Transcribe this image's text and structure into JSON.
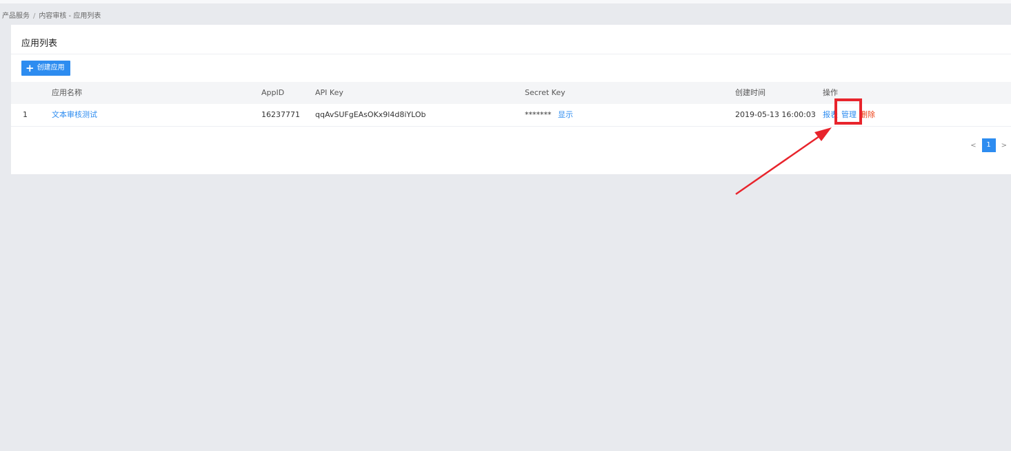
{
  "breadcrumb": {
    "root": "产品服务",
    "separator": "/",
    "current": "内容审核 - 应用列表"
  },
  "card": {
    "title": "应用列表",
    "create_button_label": "创建应用"
  },
  "table": {
    "headers": {
      "index": "",
      "name": "应用名称",
      "appid": "AppID",
      "api_key": "API Key",
      "secret_key": "Secret Key",
      "created": "创建时间",
      "actions": "操作"
    },
    "rows": [
      {
        "index": "1",
        "name": "文本审核测试",
        "appid": "16237771",
        "api_key": "qqAvSUFgEAsOKx9l4d8iYLOb",
        "secret_key_masked": "*******",
        "show_label": "显示",
        "created": "2019-05-13 16:00:03",
        "actions": {
          "report": "报表",
          "manage": "管理",
          "delete": "删除"
        }
      }
    ]
  },
  "pagination": {
    "prev": "<",
    "current_page": "1",
    "next": ">"
  },
  "colors": {
    "primary": "#2d8cf0",
    "danger": "#ed3f14",
    "annotation": "#e8242c",
    "background": "#e8eaee"
  }
}
